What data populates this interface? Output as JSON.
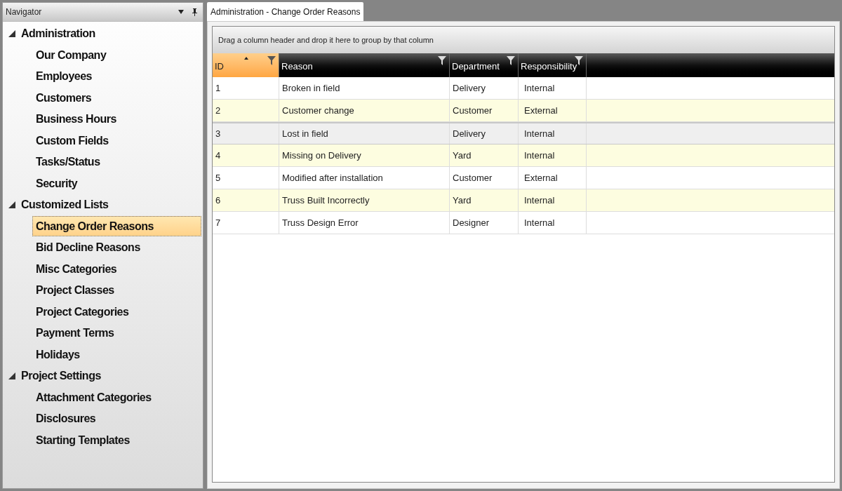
{
  "navigator": {
    "title": "Navigator",
    "groups": [
      {
        "label": "Administration",
        "expanded": true,
        "children": [
          {
            "label": "Our Company",
            "selected": false
          },
          {
            "label": "Employees",
            "selected": false
          },
          {
            "label": "Customers",
            "selected": false
          },
          {
            "label": "Business Hours",
            "selected": false
          },
          {
            "label": "Custom Fields",
            "selected": false
          },
          {
            "label": "Tasks/Status",
            "selected": false
          },
          {
            "label": "Security",
            "selected": false
          }
        ]
      },
      {
        "label": "Customized Lists",
        "expanded": true,
        "children": [
          {
            "label": "Change Order Reasons",
            "selected": true
          },
          {
            "label": "Bid Decline Reasons",
            "selected": false
          },
          {
            "label": "Misc Categories",
            "selected": false
          },
          {
            "label": "Project Classes",
            "selected": false
          },
          {
            "label": "Project Categories",
            "selected": false
          },
          {
            "label": "Payment Terms",
            "selected": false
          },
          {
            "label": "Holidays",
            "selected": false
          }
        ]
      },
      {
        "label": "Project Settings",
        "expanded": true,
        "children": [
          {
            "label": "Attachment Categories",
            "selected": false
          },
          {
            "label": "Disclosures",
            "selected": false
          },
          {
            "label": "Starting Templates",
            "selected": false
          }
        ]
      }
    ]
  },
  "tabs": [
    {
      "label": "Administration - Change Order Reasons",
      "selected": true
    }
  ],
  "grid": {
    "group_hint": "Drag a column header and drop it here to group by that column",
    "columns": [
      {
        "label": "ID",
        "sorted": true
      },
      {
        "label": "Reason",
        "sorted": false
      },
      {
        "label": "Department",
        "sorted": false
      },
      {
        "label": "Responsibility",
        "sorted": false
      }
    ],
    "rows": [
      {
        "cells": [
          "1",
          "Broken in field",
          "Delivery",
          "Internal"
        ],
        "selected": false
      },
      {
        "cells": [
          "2",
          "Customer change",
          "Customer",
          "External"
        ],
        "selected": false
      },
      {
        "cells": [
          "3",
          "Lost in field",
          "Delivery",
          "Internal"
        ],
        "selected": true
      },
      {
        "cells": [
          "4",
          "Missing on Delivery",
          "Yard",
          "Internal"
        ],
        "selected": false
      },
      {
        "cells": [
          "5",
          "Modified after installation",
          "Customer",
          "External"
        ],
        "selected": false
      },
      {
        "cells": [
          "6",
          "Truss Built Incorrectly",
          "Yard",
          "Internal"
        ],
        "selected": false
      },
      {
        "cells": [
          "7",
          "Truss Design Error",
          "Designer",
          "Internal"
        ],
        "selected": false
      }
    ]
  }
}
